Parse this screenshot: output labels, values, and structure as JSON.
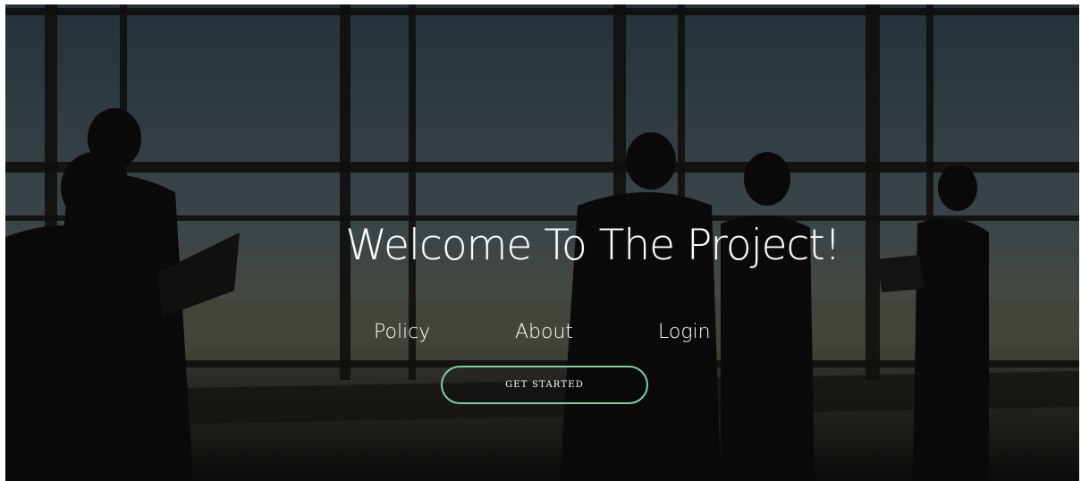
{
  "hero": {
    "title": "Welcome To The Project!",
    "background_image": "office-silhouettes-photo",
    "overlay_color": "#1c1a17"
  },
  "nav": {
    "items": [
      {
        "label": "Policy"
      },
      {
        "label": "About"
      },
      {
        "label": "Login"
      }
    ]
  },
  "cta": {
    "label": "GET STARTED",
    "border_color": "#7bd0a0"
  }
}
